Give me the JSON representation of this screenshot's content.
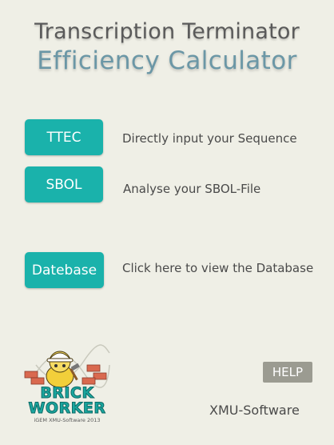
{
  "header": {
    "title_line1": "Transcription Terminator",
    "title_line2": "Efficiency Calculator"
  },
  "actions": [
    {
      "button_label": "TTEC",
      "description": "Directly input your Sequence"
    },
    {
      "button_label": "SBOL",
      "description": "Analyse your SBOL-File"
    },
    {
      "button_label": "Datebase",
      "description": "Click here to view the Database"
    }
  ],
  "logo": {
    "word1": "BRICK",
    "word2": "WORKER",
    "subtitle": "iGEM XMU-Software 2013"
  },
  "help_label": "HELP",
  "footer_text": "XMU-Software",
  "colors": {
    "background": "#efefe6",
    "button_teal": "#1ab2ab",
    "title_gray": "#5a5a5a",
    "title_blue": "#6b97a6",
    "help_gray": "#9b9b91"
  }
}
